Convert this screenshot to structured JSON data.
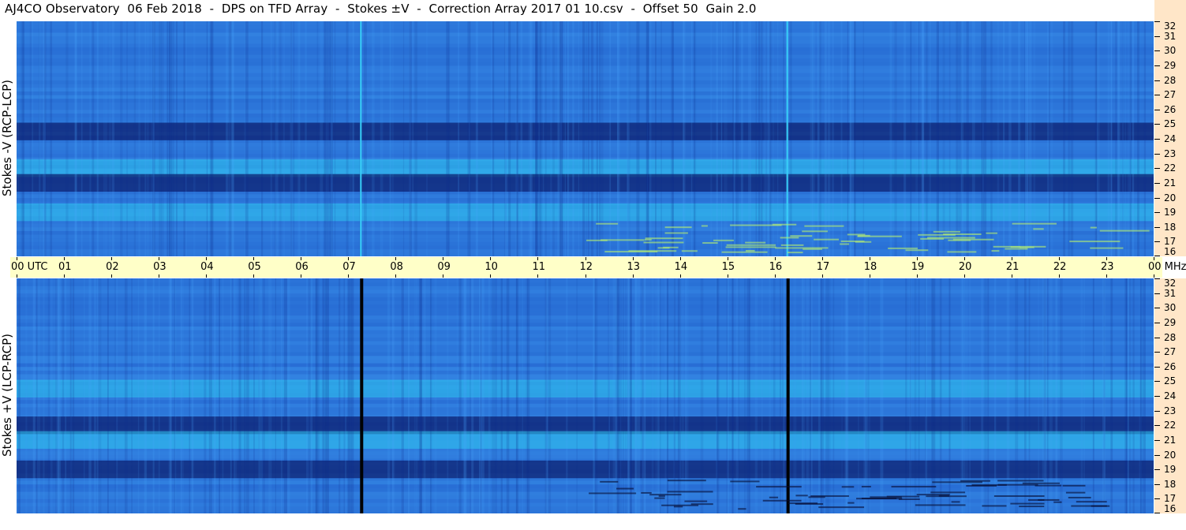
{
  "title": "AJ4CO Observatory  06 Feb 2018  -  DPS on TFD Array  -  Stokes ±V  -  Correction Array 2017 01 10.csv  -  Offset 50  Gain 2.0",
  "colors": {
    "panel_top_base": "#2a6fe0",
    "panel_bottom_base": "#2a6fe0",
    "dark_band": "#0a1a6a",
    "bright_band": "#30c8f0",
    "time_axis_bg": "#ffffc8",
    "freq_axis_bg": "#ffe6c8"
  },
  "chart_data": [
    {
      "type": "heatmap",
      "panel": "top",
      "ylabel": "Stokes -V (RCP-LCP)",
      "ylim": [
        16,
        32
      ],
      "yticks": [
        "32",
        "31",
        "30",
        "29",
        "28",
        "27",
        "26",
        "25",
        "24",
        "23",
        "22",
        "21",
        "20",
        "19",
        "18",
        "17",
        "16"
      ],
      "xlim": [
        "00",
        "00"
      ],
      "features": [
        {
          "freq": 24.5,
          "level": "dark"
        },
        {
          "freq": 22,
          "level": "bright"
        },
        {
          "freq": 21,
          "level": "dark"
        },
        {
          "freq": 19,
          "level": "bright"
        }
      ],
      "vertical_lines_utc": [
        7.25,
        16.25
      ],
      "vertical_line_style": "bright"
    },
    {
      "type": "heatmap",
      "panel": "bottom",
      "ylabel": "Stokes +V (LCP-RCP)",
      "ylim": [
        16,
        32
      ],
      "yticks": [
        "32",
        "31",
        "30",
        "29",
        "28",
        "27",
        "26",
        "25",
        "24",
        "23",
        "22",
        "21",
        "20",
        "19",
        "18",
        "17",
        "16"
      ],
      "xlim": [
        "00",
        "00"
      ],
      "features": [
        {
          "freq": 24.5,
          "level": "bright"
        },
        {
          "freq": 22,
          "level": "dark"
        },
        {
          "freq": 21,
          "level": "bright"
        },
        {
          "freq": 19,
          "level": "dark"
        }
      ],
      "vertical_lines_utc": [
        7.25,
        16.25
      ],
      "vertical_line_style": "dark"
    }
  ],
  "time_axis": {
    "labels": [
      "00",
      "01",
      "02",
      "03",
      "04",
      "05",
      "06",
      "07",
      "08",
      "09",
      "10",
      "11",
      "12",
      "13",
      "14",
      "15",
      "16",
      "17",
      "18",
      "19",
      "20",
      "21",
      "22",
      "23",
      "00"
    ],
    "start_suffix": "UTC",
    "end_suffix": "MHz"
  }
}
